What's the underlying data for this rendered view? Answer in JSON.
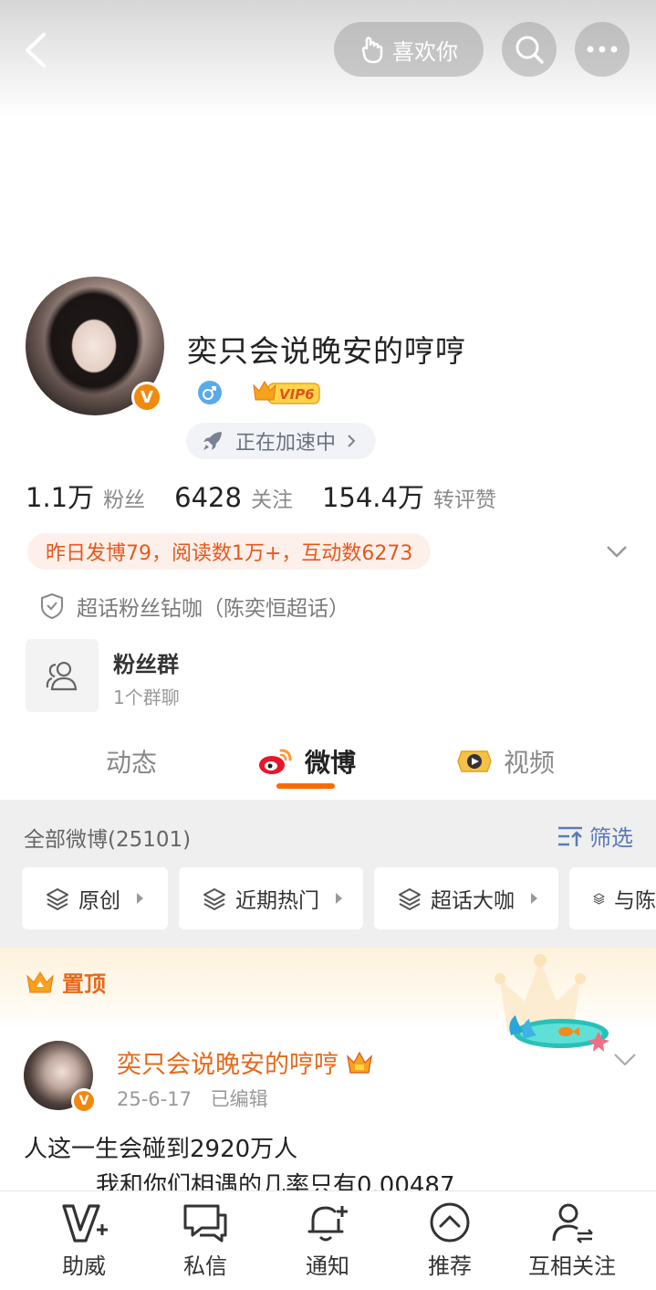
{
  "topbar": {
    "like_label": "喜欢你",
    "icons": [
      "back-icon",
      "hand-icon",
      "search-icon",
      "more-icon"
    ]
  },
  "profile": {
    "username": "奕只会说晚安的哼哼",
    "vip_label": "VIP6",
    "speed_label": "正在加速中",
    "stats": [
      {
        "value": "1.1万",
        "label": "粉丝"
      },
      {
        "value": "6428",
        "label": "关注"
      },
      {
        "value": "154.4万",
        "label": "转评赞"
      }
    ],
    "yesterday": "昨日发博79，阅读数1万+，互动数6273",
    "chaohua": "超话粉丝钻咖（陈奕恒超话）",
    "fans_group": {
      "title": "粉丝群",
      "sub": "1个群聊"
    },
    "colors": {
      "accent": "#ff6a00",
      "orange_text": "#e8681a",
      "verified": "#f08a0e"
    }
  },
  "tabs": [
    {
      "label": "动态"
    },
    {
      "label": "微博"
    },
    {
      "label": "视频"
    }
  ],
  "filter": {
    "all_label": "全部微博(25101)",
    "filter_label": "筛选",
    "chips": [
      "原创",
      "近期热门",
      "超话大咖",
      "与陈"
    ]
  },
  "pinned": {
    "label": "置顶",
    "post": {
      "author": "奕只会说晚安的哼哼",
      "date": "25-6-17",
      "edited": "已编辑",
      "line1": "人这一生会碰到2920万人",
      "line2": "我和你们相遇的几率只有0.00487"
    }
  },
  "bottom_nav": [
    {
      "label": "助威",
      "icon": "cheer-icon"
    },
    {
      "label": "私信",
      "icon": "message-icon"
    },
    {
      "label": "通知",
      "icon": "bell-plus-icon"
    },
    {
      "label": "推荐",
      "icon": "recommend-icon"
    },
    {
      "label": "互相关注",
      "icon": "mutual-follow-icon"
    }
  ]
}
